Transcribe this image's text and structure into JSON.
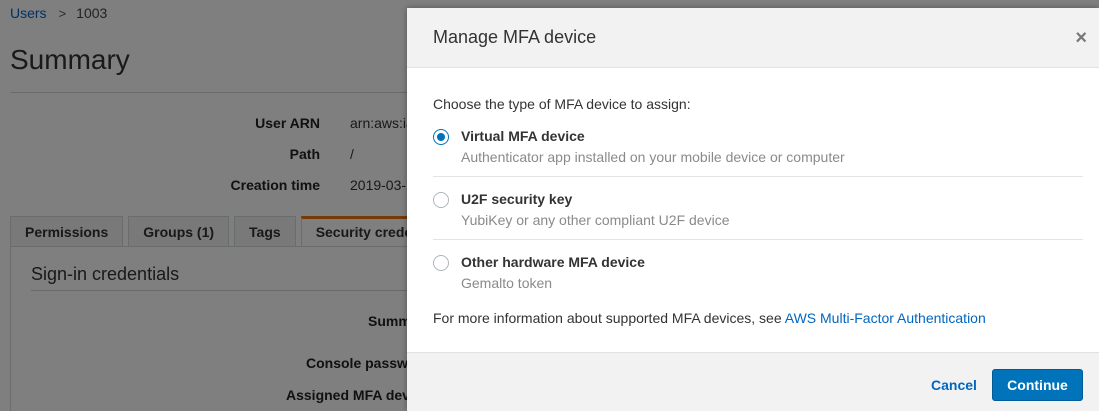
{
  "background": {
    "breadcrumb": {
      "link": "Users",
      "separator": ">",
      "current": "1003"
    },
    "title": "Summary",
    "info": [
      {
        "label": "User ARN",
        "value": "arn:aws:ia"
      },
      {
        "label": "Path",
        "value": "/"
      },
      {
        "label": "Creation time",
        "value": "2019-03-"
      }
    ],
    "tabs": [
      {
        "label": "Permissions"
      },
      {
        "label": "Groups (1)"
      },
      {
        "label": "Tags"
      },
      {
        "label": "Security crede"
      }
    ],
    "section_title": "Sign-in credentials",
    "credential_labels": [
      "Summ",
      "Console passw",
      "Assigned MFA dev"
    ]
  },
  "modal": {
    "title": "Manage MFA device",
    "close_glyph": "×",
    "prompt": "Choose the type of MFA device to assign:",
    "options": [
      {
        "label": "Virtual MFA device",
        "description": "Authenticator app installed on your mobile device or computer",
        "selected": true
      },
      {
        "label": "U2F security key",
        "description": "YubiKey or any other compliant U2F device",
        "selected": false
      },
      {
        "label": "Other hardware MFA device",
        "description": "Gemalto token",
        "selected": false
      }
    ],
    "more_info_text": "For more information about supported MFA devices, see ",
    "more_info_link": "AWS Multi-Factor Authentication",
    "cancel_label": "Cancel",
    "continue_label": "Continue"
  },
  "colors": {
    "accent": "#0073bb",
    "link": "#0066c0",
    "active_tab": "#ec7211"
  }
}
